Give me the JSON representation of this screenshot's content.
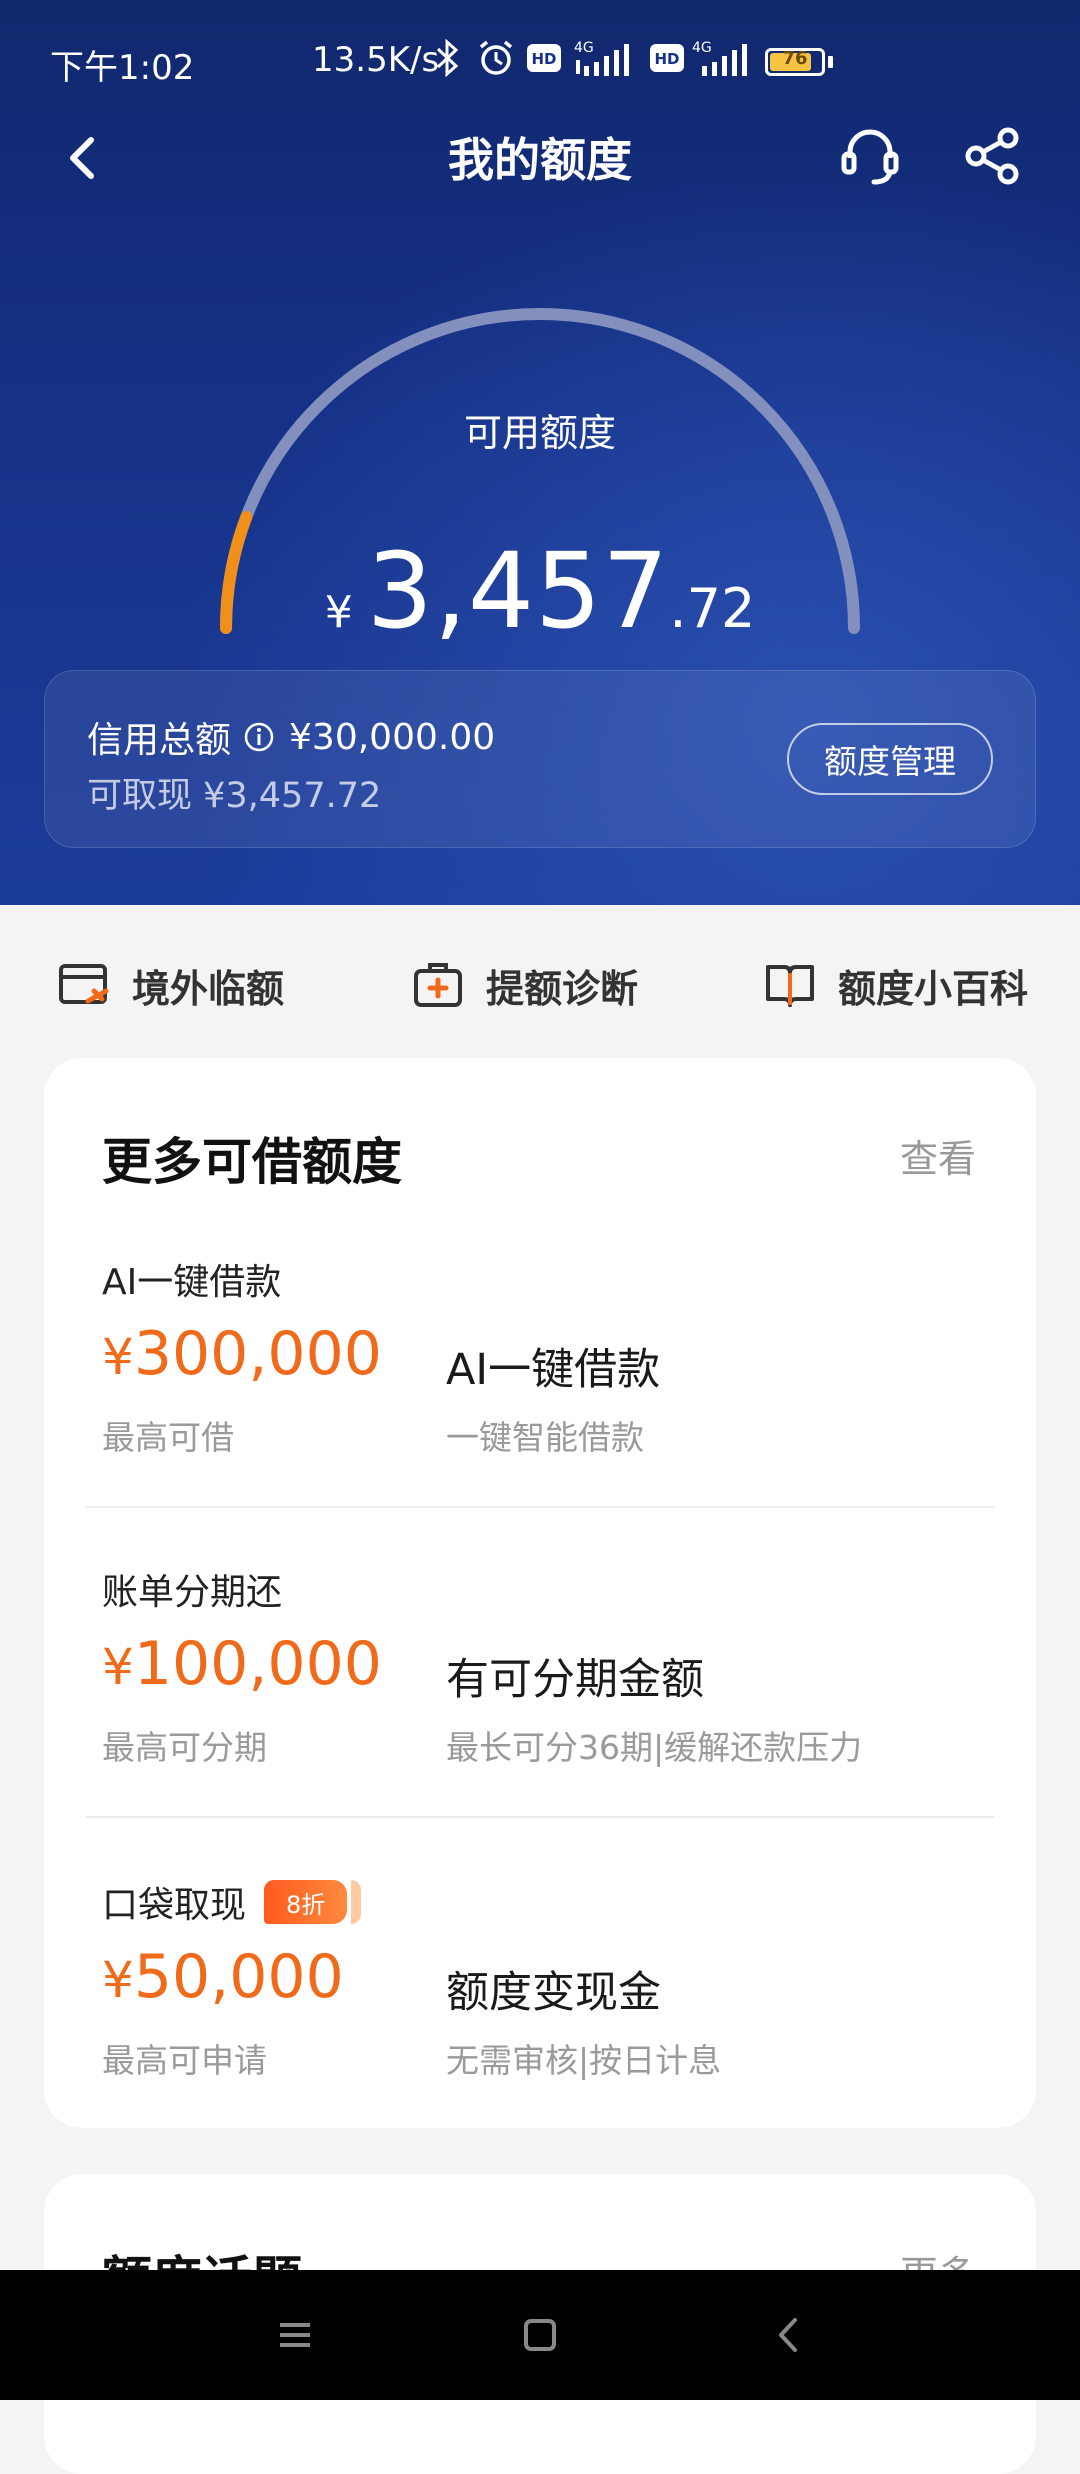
{
  "status_bar": {
    "time": "下午1:02",
    "network_speed": "13.5K/s",
    "battery": "76",
    "icons": [
      "bluetooth-icon",
      "alarm-icon",
      "hd-icon",
      "signal-4g-icon",
      "hd-icon",
      "signal-4g-icon",
      "battery-icon"
    ]
  },
  "header": {
    "title": "我的额度"
  },
  "hero": {
    "available_label": "可用额度",
    "currency": "¥",
    "amount_int": "3,457",
    "amount_dec": ".72",
    "usage_fraction": 0.115
  },
  "credit_card": {
    "total_label": "信用总额",
    "total_value": "¥30,000.00",
    "cash_label": "可取现 ¥3,457.72",
    "manage_button": "额度管理"
  },
  "quick_links": [
    {
      "label": "境外临额",
      "icon": "overseas-card-icon"
    },
    {
      "label": "提额诊断",
      "icon": "medical-kit-icon"
    },
    {
      "label": "额度小百科",
      "icon": "book-icon"
    }
  ],
  "more_credit": {
    "title": "更多可借额度",
    "more": "查看",
    "items": [
      {
        "title": "AI一键借款",
        "badge": "",
        "currency": "¥",
        "amount": "300,000",
        "sub": "最高可借",
        "head": "AI一键借款",
        "desc": "一键智能借款"
      },
      {
        "title": "账单分期还",
        "badge": "",
        "currency": "¥",
        "amount": "100,000",
        "sub": "最高可分期",
        "head": "有可分期金额",
        "desc": "最长可分36期|缓解还款压力"
      },
      {
        "title": "口袋取现",
        "badge": "8折",
        "currency": "¥",
        "amount": "50,000",
        "sub": "最高可申请",
        "head": "额度变现金",
        "desc": "无需审核|按日计息"
      }
    ]
  },
  "topics": {
    "title": "额度话题",
    "more": "更多"
  },
  "colors": {
    "accent": "#f06a1a",
    "hero_bg": "#163187"
  }
}
